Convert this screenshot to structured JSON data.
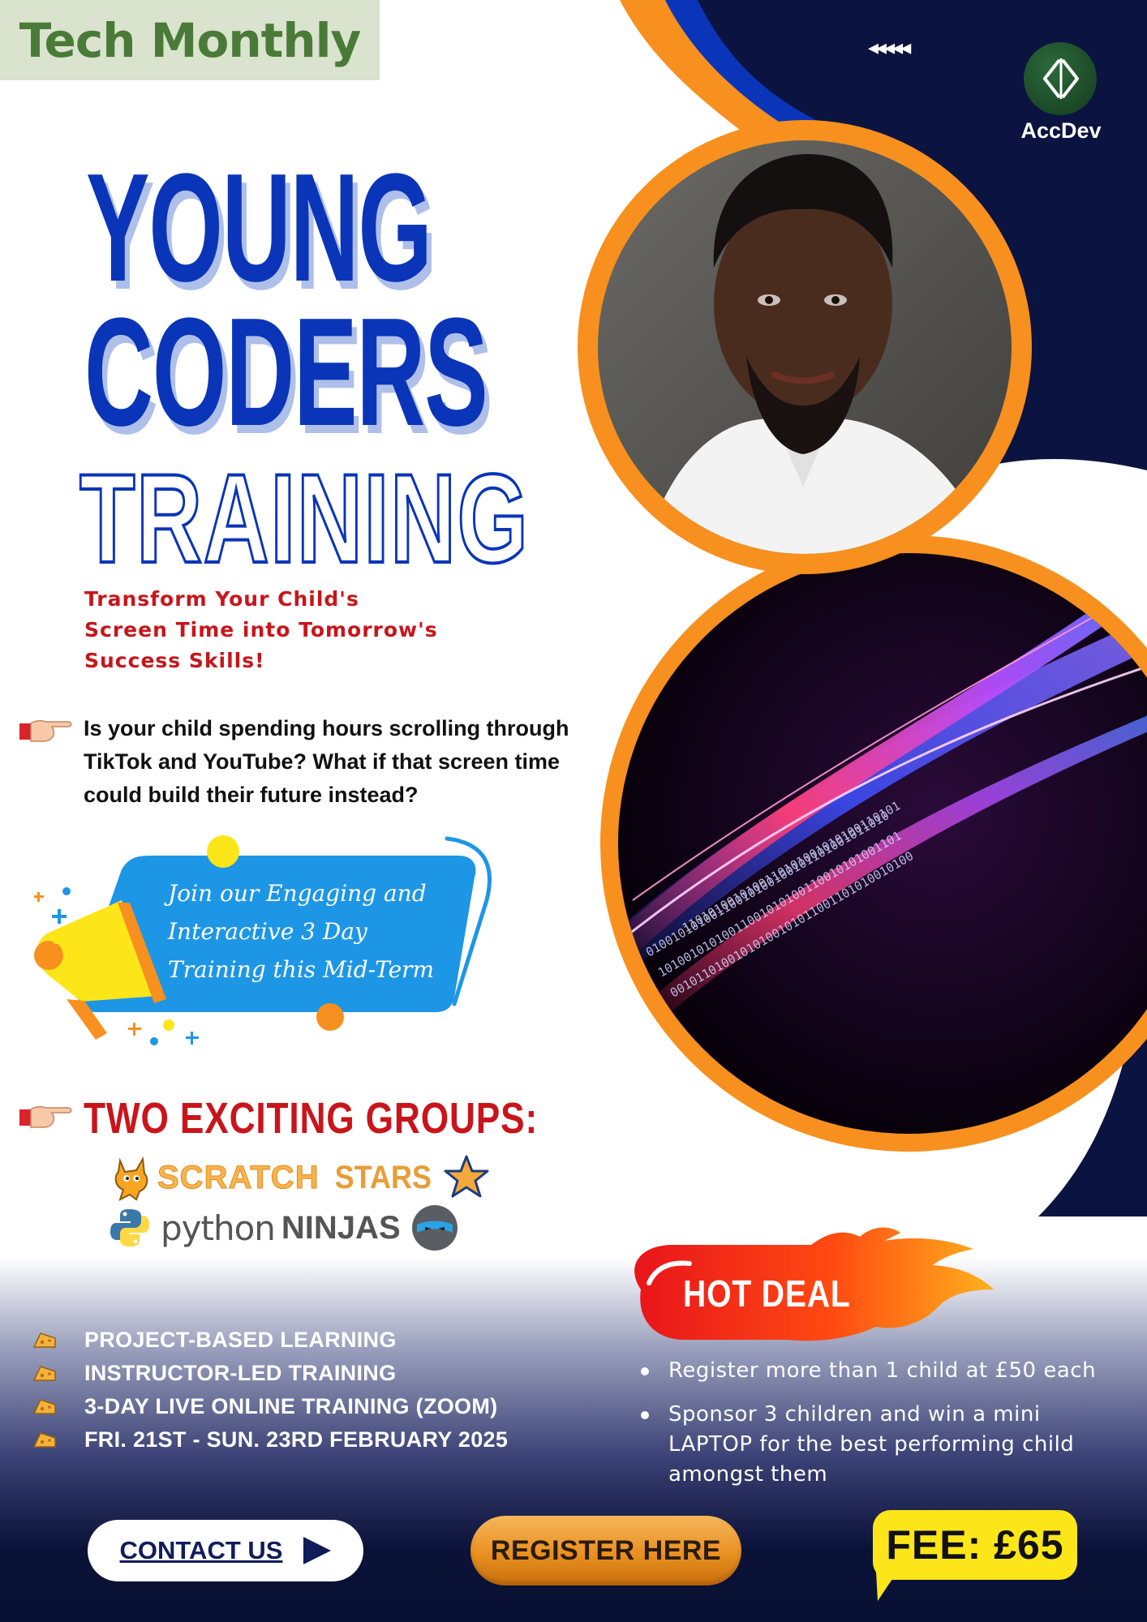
{
  "header": {
    "badge": "Tech Monthly",
    "arrows": "◂◂◂◂◂",
    "logo_label": "AccDev"
  },
  "title": {
    "line1": "YOUNG",
    "line2": "CODERS",
    "line3": "TRAINING"
  },
  "tagline": "Transform Your Child's Screen Time into Tomorrow's Success Skills!",
  "question": "Is your child spending hours scrolling through TikTok and YouTube? What if that screen time could build their future instead?",
  "promo": "Join our Engaging and Interactive 3 Day Training this Mid-Term",
  "groups": {
    "title": "TWO EXCITING GROUPS:",
    "scratch_word": "SCRATCH",
    "stars_word": "STARS",
    "python_word": "python",
    "ninjas_word": "NINJAS"
  },
  "features": [
    "PROJECT-BASED LEARNING",
    "INSTRUCTOR-LED TRAINING",
    "3-DAY LIVE ONLINE TRAINING (ZOOM)",
    "FRI. 21ST - SUN. 23RD FEBRUARY 2025"
  ],
  "hot_deal": {
    "label": "HOT DEAL",
    "items": [
      "Register more than 1 child at £50 each",
      "Sponsor 3 children and win a mini LAPTOP for the best performing child amongst them"
    ]
  },
  "buttons": {
    "contact": "CONTACT US",
    "register": "REGISTER HERE"
  },
  "fee": "FEE: £65",
  "colors": {
    "navy": "#0b1440",
    "orange": "#f7901e",
    "royal_blue": "#0a35b8",
    "red": "#c8151b",
    "badge_bg": "#d9e3cd",
    "fee_yellow": "#fce61a"
  }
}
